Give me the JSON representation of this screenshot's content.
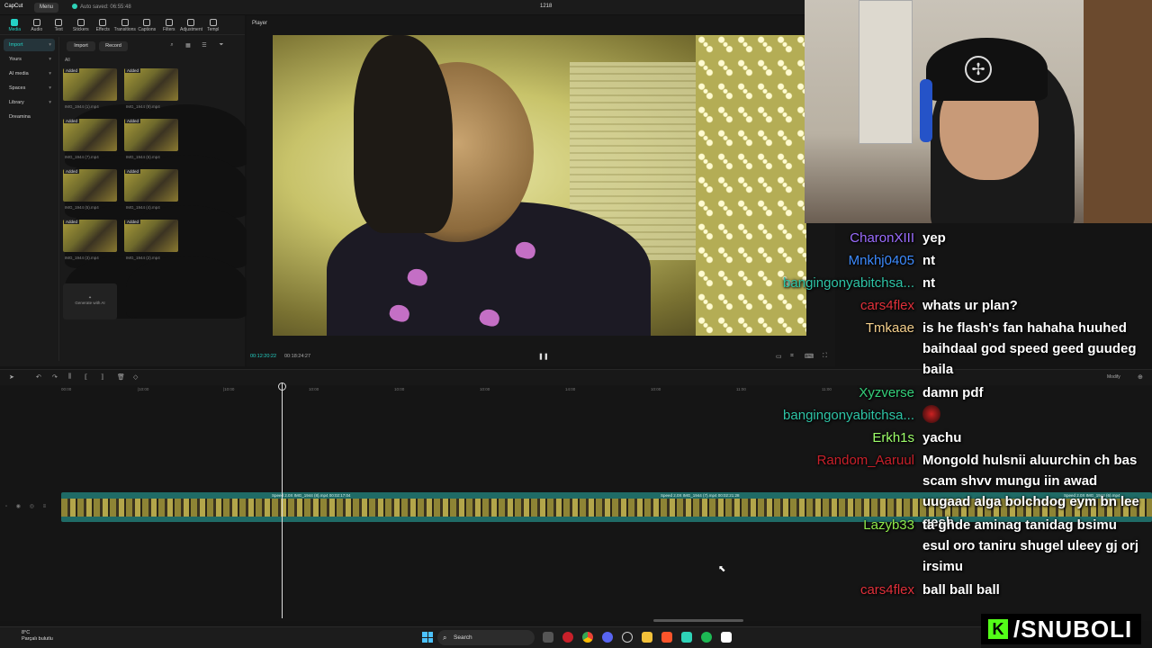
{
  "app": {
    "logo": "CapCut",
    "menu": "Menu",
    "autosave": "Auto saved: 06:55:48",
    "project": "1218"
  },
  "toolbar": [
    "Media",
    "Audio",
    "Text",
    "Stickers",
    "Effects",
    "Transitions",
    "Captions",
    "Filters",
    "Adjustment",
    "Templ"
  ],
  "sidenav": [
    "Import",
    "Yours",
    "AI media",
    "Spaces",
    "Library",
    "Dreamina"
  ],
  "media": {
    "import": "Import",
    "record": "Record",
    "all": "All",
    "added": "Added",
    "files": [
      "IMG_1944 (1).mp4",
      "IMG_1944 (8).mp4",
      "IMG_1944 (7).mp4",
      "IMG_1944 (6).mp4",
      "IMG_1944 (5).mp4",
      "IMG_1944 (4).mp4",
      "IMG_1944 (3).mp4",
      "IMG_1944 (2).mp4"
    ],
    "generate": "Generate with AI"
  },
  "player": {
    "title": "Player",
    "current": "00:12:20:22",
    "total": "00:18:24:27"
  },
  "ruler": [
    "00:00",
    "|10:00",
    "|10:00",
    "10:00",
    "10:00",
    "10:00",
    "14:00",
    "10:00",
    "11:00",
    "11:00"
  ],
  "clips": [
    {
      "label": "Speed 2.0X  IMG_1944 (8).mp4  00:02:17:04"
    },
    {
      "label": "Speed 2.0X  IMG_1944 (7).mp4  00:02:21:28"
    },
    {
      "label": "Speed 2.0X  IMG_1944 (6).mp4"
    }
  ],
  "chat": [
    {
      "user": "CharonXIII",
      "color": "#9b6cff",
      "text": "yep"
    },
    {
      "user": "Mnkhj0405",
      "color": "#3d8bff",
      "text": "nt"
    },
    {
      "user": "bangingonyabitchsa...",
      "color": "#2ec4a6",
      "text": "nt"
    },
    {
      "user": "cars4flex",
      "color": "#e0303a",
      "text": "whats ur plan?"
    },
    {
      "user": "Tmkaae",
      "color": "#f4cf8c",
      "text": "is he flash's fan hahaha huuhed baihdaal god speed geed guudeg baila"
    },
    {
      "user": "Xyzverse",
      "color": "#34d07a",
      "text": "damn pdf"
    },
    {
      "user": "bangingonyabitchsa...",
      "color": "#2ec4a6",
      "text": ""
    },
    {
      "user": "Erkh1s",
      "color": "#9dff6a",
      "text": "yachu"
    },
    {
      "user": "Random_Aaruul",
      "color": "#c8202a",
      "text": "Mongold hulsnii aluurchin ch bas scam shvv mungu iin awad uugaad alga bolchdog eym bn lee gesh"
    },
    {
      "user": "Lazyb33",
      "color": "#8ee84a",
      "text": "ta ghde aminag tanidag bsimu esul oro taniru shugel uleey gj orj irsimu"
    },
    {
      "user": "cars4flex",
      "color": "#e0303a",
      "text": "ball ball ball"
    }
  ],
  "brand": {
    "handle": "/SNUBOLI",
    "k": "K"
  },
  "taskbar": {
    "temp": "8°C",
    "weather": "Parçalı bulutlu",
    "search": "Search"
  },
  "modify": "Modify"
}
